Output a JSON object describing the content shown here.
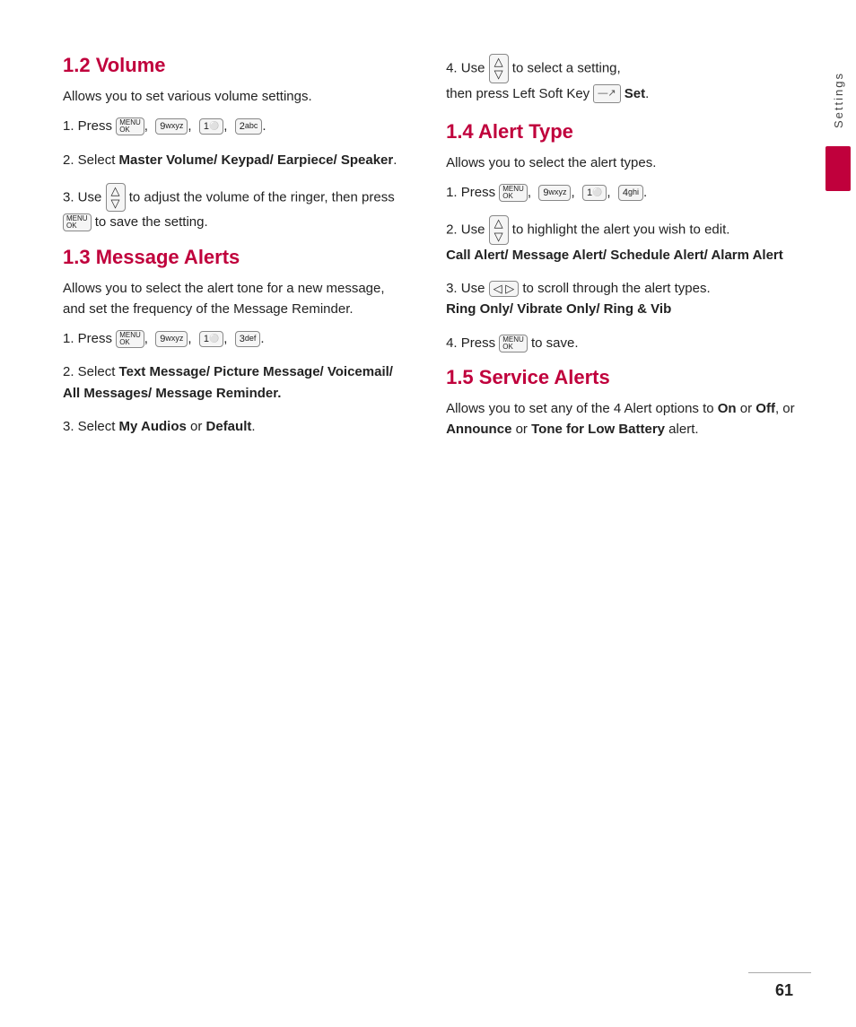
{
  "page_number": "61",
  "sidebar_label": "Settings",
  "left_col": {
    "section_1_2": {
      "title": "1.2 Volume",
      "desc": "Allows you to set various volume settings.",
      "steps": [
        {
          "num": "1.",
          "text_pre": "Press",
          "keys": [
            "MENU OK",
            "9 wxyz",
            "1",
            "2 abc"
          ],
          "text_post": "."
        },
        {
          "num": "2.",
          "text": "Select Master Volume/ Keypad/ Earpiece/ Speaker.",
          "bold_part": "Master Volume/ Keypad/ Earpiece/ Speaker"
        },
        {
          "num": "3.",
          "text": "Use  to adjust the volume of the ringer, then press  to save the setting."
        }
      ]
    },
    "section_1_3": {
      "title": "1.3 Message Alerts",
      "desc": "Allows you to select the alert tone for a new message, and set the frequency of the Message Reminder.",
      "steps": [
        {
          "num": "1.",
          "text_pre": "Press",
          "keys": [
            "MENU OK",
            "9 wxyz",
            "1",
            "3 def"
          ],
          "text_post": "."
        },
        {
          "num": "2.",
          "text": "Select Text Message/ Picture Message/ Voicemail/ All Messages/ Message Reminder.",
          "bold_part": "Text Message/ Picture Message/ Voicemail/ All Messages/ Message Reminder."
        },
        {
          "num": "3.",
          "text": "Select My Audios or Default.",
          "bold_parts": [
            "My Audios",
            "Default"
          ]
        }
      ]
    }
  },
  "right_col": {
    "section_1_4_step4": {
      "num": "4.",
      "text": "Use  to select a setting, then press Left Soft Key  Set."
    },
    "section_1_4": {
      "title": "1.4 Alert Type",
      "desc": "Allows you to select the alert types.",
      "steps": [
        {
          "num": "1.",
          "text_pre": "Press",
          "keys": [
            "MENU OK",
            "9 wxyz",
            "1",
            "4 ghi"
          ],
          "text_post": "."
        },
        {
          "num": "2.",
          "text": "Use  to highlight the alert you wish to edit. Call Alert/ Message Alert/ Schedule Alert/ Alarm Alert",
          "bold_part": "Call Alert/ Message Alert/ Schedule Alert/ Alarm Alert"
        },
        {
          "num": "3.",
          "text": "Use  to scroll through the alert types. Ring Only/ Vibrate Only/ Ring & Vib",
          "bold_part": "Ring Only/ Vibrate Only/ Ring & Vib"
        },
        {
          "num": "4.",
          "text": "Press  to save.",
          "key": "MENU OK"
        }
      ]
    },
    "section_1_5": {
      "title": "1.5 Service Alerts",
      "desc": "Allows you to set any of the 4 Alert options to On or Off, or Announce or Tone for Low Battery alert.",
      "bold_parts": [
        "On",
        "Off",
        "Announce",
        "Tone for Low Battery"
      ]
    }
  }
}
